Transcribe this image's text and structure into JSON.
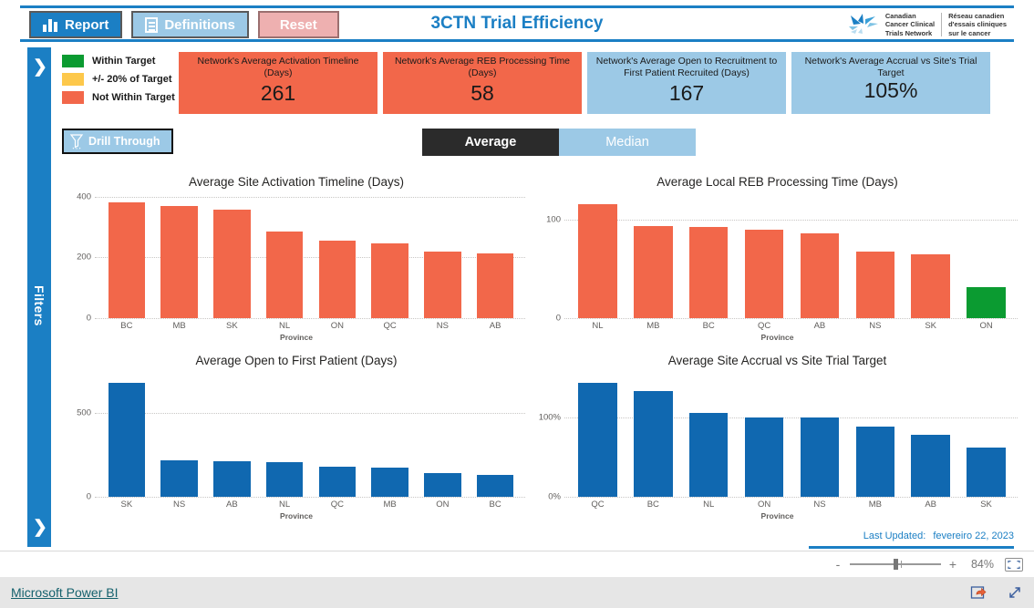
{
  "header": {
    "title": "3CTN Trial Efficiency",
    "buttons": [
      {
        "label": "Report",
        "icon": "bar-chart-icon"
      },
      {
        "label": "Definitions",
        "icon": "document-icon"
      },
      {
        "label": "Reset",
        "icon": "none"
      }
    ],
    "logo": {
      "en": "Canadian\nCancer Clinical\nTrials Network",
      "fr": "Réseau canadien\nd'essais cliniques\nsur le cancer"
    }
  },
  "filters_pane": {
    "label": "Filters",
    "expand_icon": "chevron-right-icon"
  },
  "legend": {
    "items": [
      {
        "label": "Within Target",
        "color": "#0b9b31"
      },
      {
        "label": "+/- 20% of Target",
        "color": "#fdc84b"
      },
      {
        "label": "Not Within Target",
        "color": "#f2674a"
      }
    ]
  },
  "kpis": [
    {
      "title": "Network's Average Activation Timeline (Days)",
      "value": "261",
      "color": "#f2674a"
    },
    {
      "title": "Network's Average REB Processing Time (Days)",
      "value": "58",
      "color": "#f2674a"
    },
    {
      "title": "Network's Average Open to Recruitment to First Patient Recruited (Days)",
      "value": "167",
      "color": "#9cc9e6"
    },
    {
      "title": "Network's Average Accrual vs Site's Trial Target",
      "value": "105%",
      "color": "#9cc9e6"
    }
  ],
  "drill_through": {
    "label": "Drill Through",
    "icon": "funnel-icon"
  },
  "stat_toggle": {
    "options": [
      {
        "label": "Average",
        "selected": true
      },
      {
        "label": "Median",
        "selected": false
      }
    ]
  },
  "last_updated": {
    "label": "Last Updated:",
    "value": "fevereiro 22, 2023"
  },
  "status_bar": {
    "zoom_minus": "-",
    "zoom_plus": "+",
    "zoom_value": "84%",
    "fit_icon": "fit-to-page-icon"
  },
  "taskbar": {
    "brand": "Microsoft Power BI",
    "share_icon": "share-icon",
    "fullscreen_icon": "fullscreen-icon"
  },
  "chart_data": [
    {
      "type": "bar",
      "title": "Average Site Activation Timeline (Days)",
      "xlabel": "Province",
      "ylabel": "",
      "categories": [
        "BC",
        "MB",
        "SK",
        "NL",
        "ON",
        "QC",
        "NS",
        "AB"
      ],
      "values": [
        380,
        370,
        358,
        285,
        255,
        245,
        218,
        213
      ],
      "colors": [
        "#f2674a",
        "#f2674a",
        "#f2674a",
        "#f2674a",
        "#f2674a",
        "#f2674a",
        "#f2674a",
        "#f2674a"
      ],
      "ylim": [
        0,
        420
      ],
      "yticks": [
        0,
        200,
        400
      ],
      "ytick_labels": [
        "0",
        "200",
        "400"
      ],
      "grid": true,
      "legend": "none"
    },
    {
      "type": "bar",
      "title": "Average Local REB Processing Time (Days)",
      "xlabel": "Province",
      "ylabel": "",
      "categories": [
        "NL",
        "MB",
        "BC",
        "QC",
        "AB",
        "NS",
        "SK",
        "ON"
      ],
      "values": [
        116,
        94,
        93,
        90,
        86,
        68,
        65,
        32
      ],
      "colors": [
        "#f2674a",
        "#f2674a",
        "#f2674a",
        "#f2674a",
        "#f2674a",
        "#f2674a",
        "#f2674a",
        "#0b9b31"
      ],
      "ylim": [
        0,
        130
      ],
      "yticks": [
        0,
        100
      ],
      "ytick_labels": [
        "0",
        "100"
      ],
      "grid": true,
      "legend": "none"
    },
    {
      "type": "bar",
      "title": "Average Open to First Patient (Days)",
      "xlabel": "Province",
      "ylabel": "",
      "categories": [
        "SK",
        "NS",
        "AB",
        "NL",
        "QC",
        "MB",
        "ON",
        "BC"
      ],
      "values": [
        680,
        215,
        210,
        205,
        180,
        175,
        140,
        132
      ],
      "colors": [
        "#1068b0",
        "#1068b0",
        "#1068b0",
        "#1068b0",
        "#1068b0",
        "#1068b0",
        "#1068b0",
        "#1068b0"
      ],
      "ylim": [
        0,
        760
      ],
      "yticks": [
        0,
        500
      ],
      "ytick_labels": [
        "0",
        "500"
      ],
      "grid": true,
      "legend": "none"
    },
    {
      "type": "bar",
      "title": "Average Site Accrual vs Site Trial Target",
      "xlabel": "Province",
      "ylabel": "",
      "categories": [
        "QC",
        "BC",
        "NL",
        "ON",
        "NS",
        "MB",
        "AB",
        "SK"
      ],
      "values": [
        143,
        133,
        105,
        100,
        99,
        88,
        78,
        62
      ],
      "colors": [
        "#1068b0",
        "#1068b0",
        "#1068b0",
        "#1068b0",
        "#1068b0",
        "#1068b0",
        "#1068b0",
        "#1068b0"
      ],
      "ylim": [
        0,
        160
      ],
      "yticks": [
        0,
        100
      ],
      "ytick_labels": [
        "0%",
        "100%"
      ],
      "grid": true,
      "legend": "none"
    }
  ]
}
